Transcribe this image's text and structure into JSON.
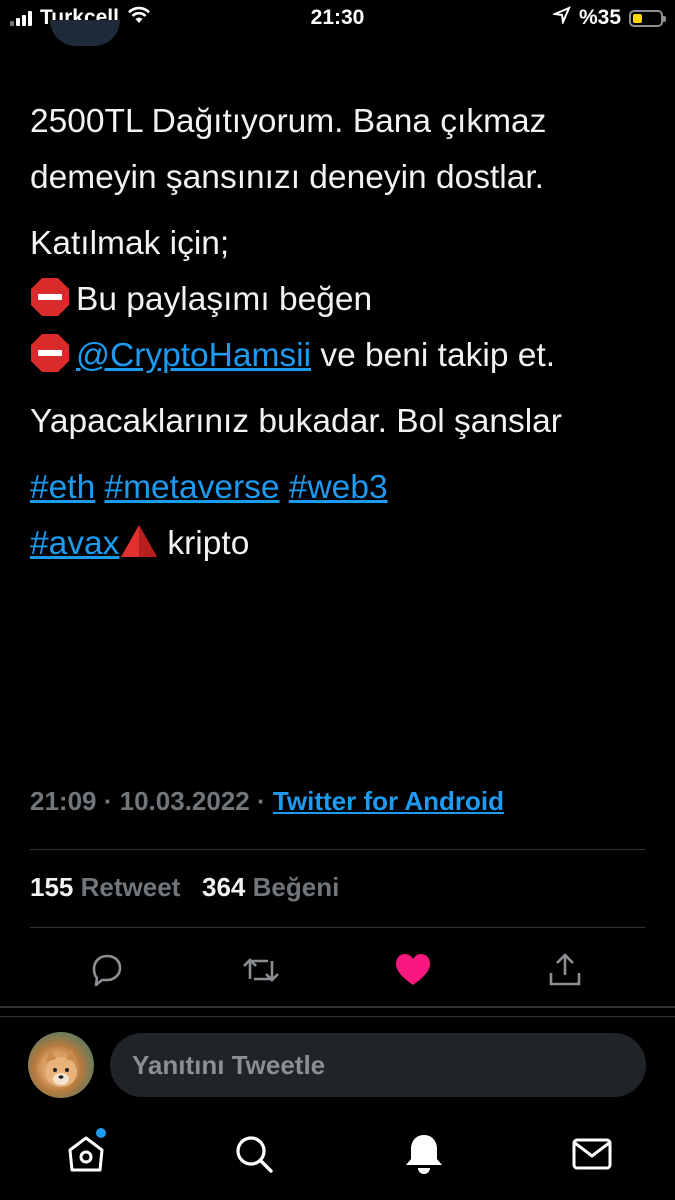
{
  "status_bar": {
    "carrier": "Turkcell",
    "time": "21:30",
    "battery_percent": "%35",
    "battery_level": 0.35,
    "icons": [
      "signal-icon",
      "wifi-icon",
      "location-arrow-icon",
      "battery-icon"
    ]
  },
  "tweet": {
    "line1": "2500TL Dağıtıyorum. Bana çıkmaz demeyin şansınızı deneyin dostlar.",
    "line2": "Katılmak için;",
    "line3": "Bu paylaşımı beğen",
    "mention": "@CryptoHamsii",
    "line4_rest": " ve beni takip et.",
    "line5": "Yapacaklarınız bukadar. Bol şanslar",
    "hashtags": [
      "#eth",
      "#metaverse",
      "#web3",
      "#avax"
    ],
    "tail_word": "kripto",
    "emojis": [
      "stop-sign-emoji",
      "red-triangle-emoji"
    ]
  },
  "meta": {
    "time": "21:09",
    "separator": "·",
    "date": "10.03.2022",
    "source": "Twitter for Android"
  },
  "stats": {
    "retweets": "155",
    "retweets_label": "Retweet",
    "likes": "364",
    "likes_label": "Beğeni"
  },
  "actions": {
    "icons": [
      "reply-icon",
      "retweet-icon",
      "like-icon",
      "share-icon"
    ],
    "liked": true,
    "like_color": "#f91880"
  },
  "reply": {
    "placeholder": "Yanıtını Tweetle"
  },
  "nav": {
    "icons": [
      "home-icon",
      "search-icon",
      "notifications-icon",
      "messages-icon"
    ],
    "home_has_dot": true
  },
  "colors": {
    "background": "#000000",
    "accent": "#1d9bf0",
    "muted": "#71767b"
  }
}
